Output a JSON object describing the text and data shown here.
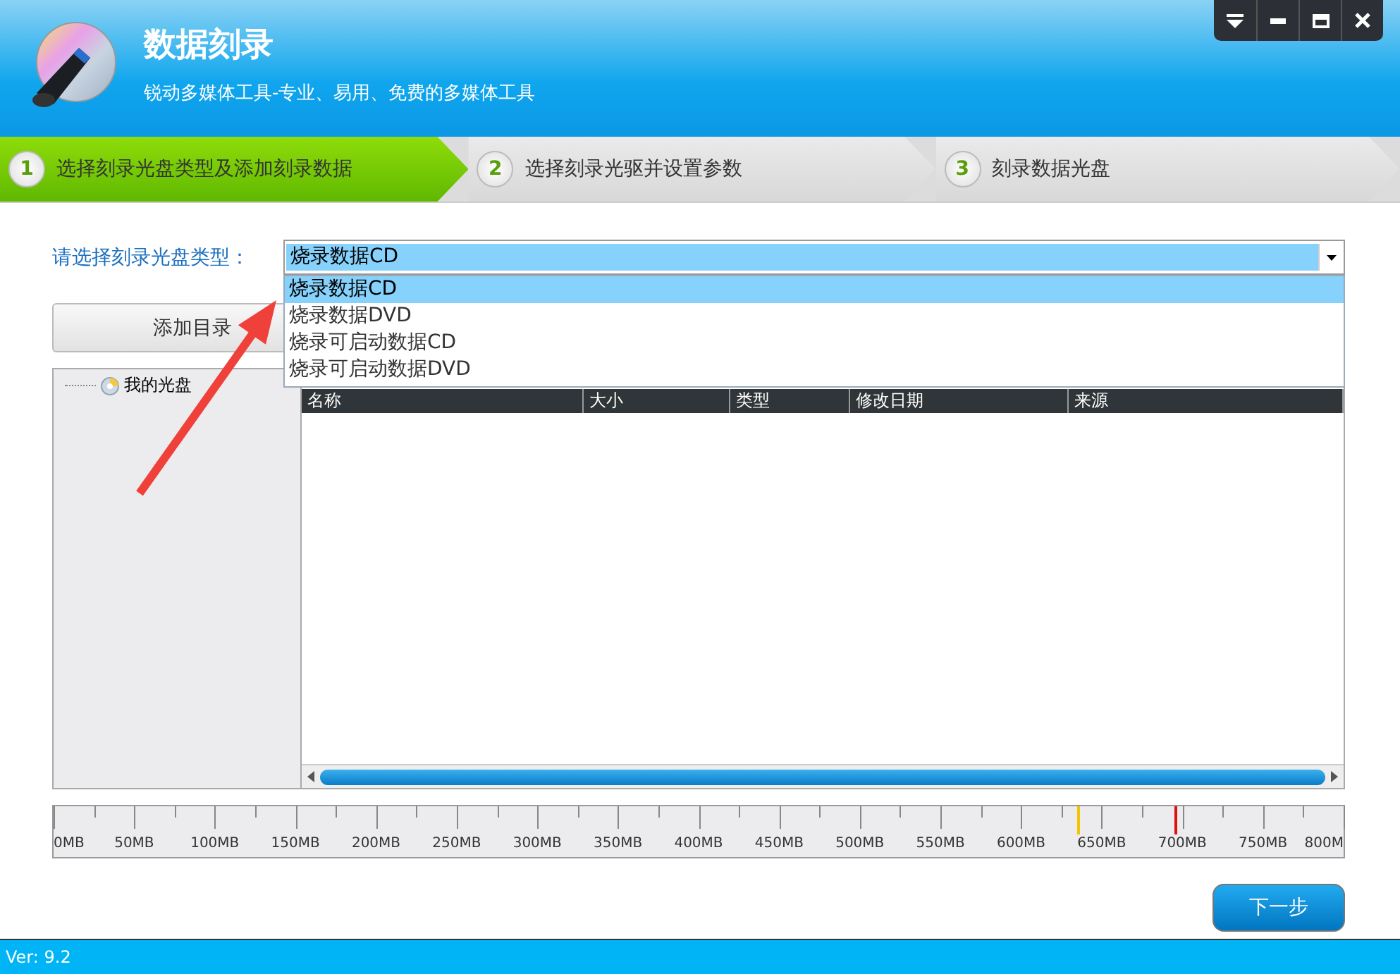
{
  "window": {
    "title": "数据刻录",
    "subtitle": "锐动多媒体工具-专业、易用、免费的多媒体工具",
    "controls": [
      {
        "kind": "dropdown"
      },
      {
        "kind": "minimize"
      },
      {
        "kind": "maximize"
      },
      {
        "kind": "close"
      }
    ]
  },
  "steps": [
    {
      "number": "1",
      "label": "选择刻录光盘类型及添加刻录数据",
      "selected": true
    },
    {
      "number": "2",
      "label": "选择刻录光驱并设置参数",
      "selected": false
    },
    {
      "number": "3",
      "label": "刻录数据光盘",
      "selected": false
    }
  ],
  "disc_type": {
    "label": "请选择刻录光盘类型：",
    "value": "烧录数据CD",
    "expanded": true,
    "options": [
      {
        "label": "烧录数据CD",
        "selected": true
      },
      {
        "label": "烧录数据DVD",
        "selected": false
      },
      {
        "label": "烧录可启动数据CD",
        "selected": false
      },
      {
        "label": "烧录可启动数据DVD",
        "selected": false
      }
    ]
  },
  "add_button": "添加目录",
  "tree": {
    "items": [
      {
        "label": "我的光盘"
      }
    ]
  },
  "table": {
    "columns": [
      "名称",
      "大小",
      "类型",
      "修改日期",
      "来源"
    ]
  },
  "ruler": {
    "labels": [
      "0MB",
      "50MB",
      "100MB",
      "150MB",
      "200MB",
      "250MB",
      "300MB",
      "350MB",
      "400MB",
      "450MB",
      "500MB",
      "550MB",
      "600MB",
      "650MB",
      "700MB",
      "750MB",
      "800M"
    ],
    "marks": [
      {
        "color": "#f5c400",
        "level": 0.793
      },
      {
        "color": "#e01010",
        "level": 0.869
      }
    ]
  },
  "next_button": "下一步",
  "status_bar": "Ver: 9.2"
}
